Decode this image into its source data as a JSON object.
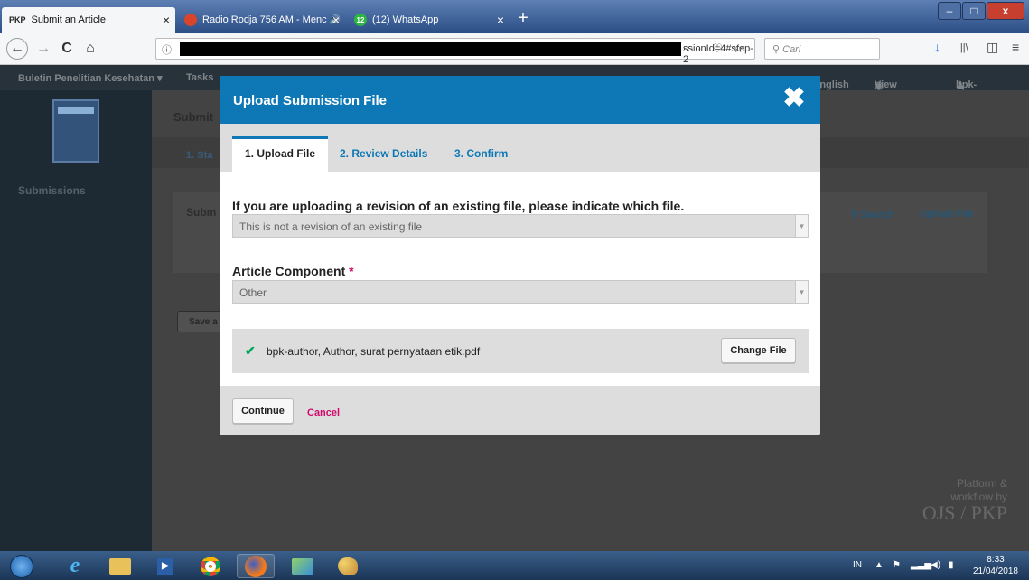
{
  "browser": {
    "tabs": [
      {
        "favicon": "PKP",
        "label": "Submit an Article",
        "close": "×"
      },
      {
        "label": "Radio Rodja 756 AM - Menc",
        "audio": "🔊",
        "close": "×"
      },
      {
        "favicon": "12",
        "label": "(12) WhatsApp",
        "close": "×"
      }
    ],
    "new_tab": "+",
    "window_controls": {
      "minimize": "–",
      "maximize": "□",
      "close": "x"
    },
    "nav": {
      "back": "←",
      "forward": "→",
      "reload": "C",
      "home": "⌂"
    },
    "url": {
      "info": "ⓘ",
      "visible_text": "ssionId=4#step-2",
      "tools": "··· ♡ ☆"
    },
    "search_placeholder": "Cari",
    "toolbar_icons": {
      "download": "↓",
      "library": "|||\\",
      "sidebar": "◫",
      "menu": "≡"
    }
  },
  "app_header": {
    "journal": "Buletin Penelitian Kesehatan ▾",
    "tasks": "Tasks",
    "language": "English",
    "view_site": "View Site",
    "user": "bpk-author"
  },
  "sidebar": {
    "submissions": "Submissions"
  },
  "background_page": {
    "title_partial": "Submit",
    "step_partial": "1. Sta",
    "panel_title_partial": "Subm",
    "search_link": "Search",
    "upload_link": "Upload File",
    "save_partial": "Save a",
    "footer": {
      "line1": "Platform &",
      "line2": "workflow by",
      "brand": "OJS / PKP"
    }
  },
  "modal": {
    "title": "Upload Submission File",
    "close_glyph": "✖",
    "tabs": [
      {
        "label": "1. Upload File",
        "active": true
      },
      {
        "label": "2. Review Details",
        "active": false
      },
      {
        "label": "3. Confirm",
        "active": false
      }
    ],
    "revision": {
      "label": "If you are uploading a revision of an existing file, please indicate which file.",
      "value": "This is not a revision of an existing file"
    },
    "component": {
      "label": "Article Component",
      "required_mark": "*",
      "value": "Other"
    },
    "file": {
      "name": "bpk-author, Author, surat pernyataan etik.pdf",
      "change_button": "Change File"
    },
    "footer": {
      "continue": "Continue",
      "cancel": "Cancel"
    }
  },
  "taskbar": {
    "language": "IN",
    "clock_time": "8:33",
    "clock_date": "21/04/2018"
  },
  "colors": {
    "modal_header": "#0d78b5",
    "required": "#d00a6c",
    "check": "#00a65a",
    "link": "#0d78b5"
  }
}
